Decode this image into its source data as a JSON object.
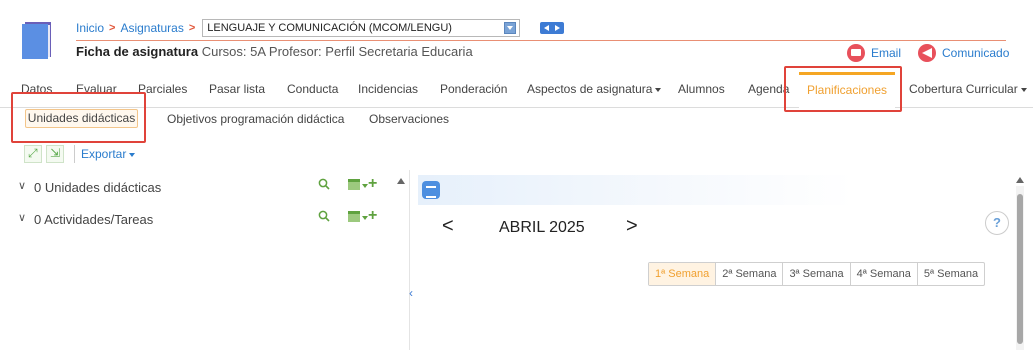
{
  "header": {
    "breadcrumb": [
      "Inicio",
      "Asignaturas"
    ],
    "subject_value": "LENGUAJE Y COMUNICACIÓN (MCOM/LENGU)",
    "title_bold": "Ficha de asignatura",
    "title_desc": "Cursos: 5A Profesor: Perfil Secretaria Educaria",
    "email_label": "Email",
    "comunicado_label": "Comunicado"
  },
  "main_tabs": [
    "Datos",
    "Evaluar",
    "Parciales",
    "Pasar lista",
    "Conducta",
    "Incidencias",
    "Ponderación",
    "Aspectos de asignatura",
    "Alumnos",
    "Agenda",
    "Planificaciones",
    "Cobertura Curricular"
  ],
  "sub_tabs": [
    "Unidades didácticas",
    "Objetivos programación didáctica",
    "Observaciones"
  ],
  "toolbar": {
    "export_label": "Exportar"
  },
  "tree": [
    {
      "label": "0 Unidades didácticas"
    },
    {
      "label": "0 Actividades/Tareas"
    }
  ],
  "calendar": {
    "month_label": "ABRIL 2025",
    "prev": "<",
    "next": ">",
    "help": "?",
    "weeks": [
      "1ª Semana",
      "2ª Semana",
      "3ª Semana",
      "4ª Semana",
      "5ª Semana"
    ]
  },
  "colors": {
    "accent": "#f0a030",
    "link": "#2a7ccd",
    "highlight_box": "#e0433a"
  }
}
